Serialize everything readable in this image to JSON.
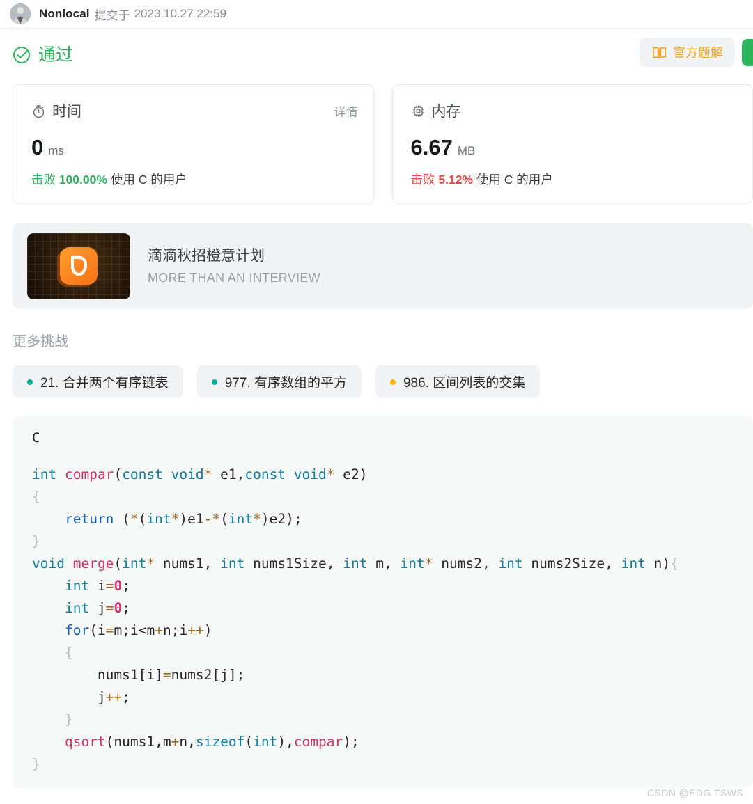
{
  "submission": {
    "username": "Nonlocal",
    "submitted_label": "提交于",
    "timestamp": "2023.10.27 22:59",
    "avatar_icon": "user-avatar"
  },
  "status": {
    "result_text": "通过",
    "result_color": "#2db55d",
    "check_icon": "circle-check-icon",
    "solution_button": {
      "label": "官方题解",
      "icon": "book-icon",
      "color": "#f5a623"
    },
    "green_button": {
      "label": "",
      "color": "#2db55d"
    }
  },
  "stats": [
    {
      "icon": "stopwatch-icon",
      "title": "时间",
      "detail_label": "详情",
      "value": "0",
      "unit": "ms",
      "beat_prefix": "击败",
      "beat_percent": "100.00%",
      "beat_suffix": "使用 C 的用户",
      "beat_color": "#2db55d"
    },
    {
      "icon": "memory-chip-icon",
      "title": "内存",
      "detail_label": "",
      "value": "6.67",
      "unit": "MB",
      "beat_prefix": "击败",
      "beat_percent": "5.12%",
      "beat_suffix": "使用 C 的用户",
      "beat_color": "#ef4743"
    }
  ],
  "ad": {
    "logo_icon": "didi-logo-icon",
    "title": "滴滴秋招橙意计划",
    "subtitle": "MORE THAN AN INTERVIEW"
  },
  "more_challenges": {
    "label": "更多挑战",
    "items": [
      {
        "text": "21. 合并两个有序链表",
        "dot_color": "#00af9b"
      },
      {
        "text": "977. 有序数组的平方",
        "dot_color": "#00af9b"
      },
      {
        "text": "986. 区间列表的交集",
        "dot_color": "#ffb800"
      }
    ]
  },
  "code": {
    "language": "C",
    "lines": [
      "int compar(const void* e1,const void* e2)",
      "{",
      "    return (*(int*)e1-*(int*)e2);",
      "}",
      "void merge(int* nums1, int nums1Size, int m, int* nums2, int nums2Size, int n){",
      "    int i=0;",
      "    int j=0;",
      "    for(i=m;i<m+n;i++)",
      "    {",
      "        nums1[i]=nums2[j];",
      "        j++;",
      "    }",
      "    qsort(nums1,m+n,sizeof(int),compar);",
      "}"
    ]
  },
  "watermark": "CSDN @EDG.TSWS"
}
